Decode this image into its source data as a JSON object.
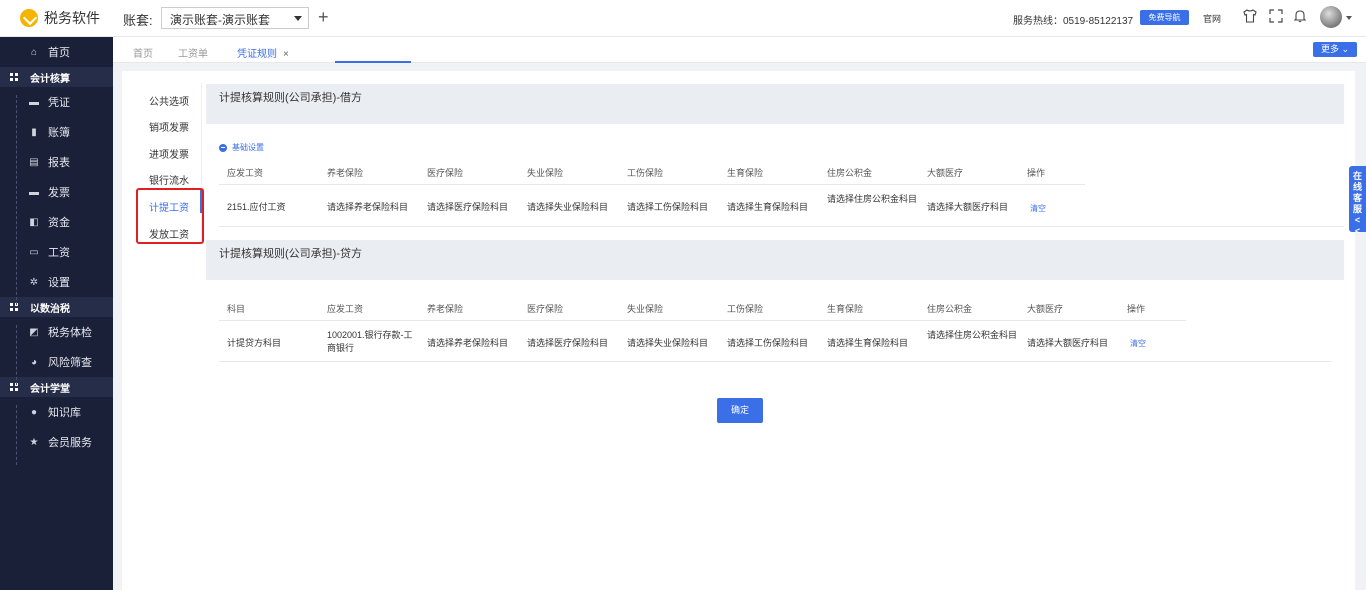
{
  "app": {
    "name": "税务软件"
  },
  "header": {
    "account_label": "账套:",
    "account_value": "演示账套-演示账套",
    "add_symbol": "+",
    "hotline": "服务热线：0519-85122137",
    "free_nav": "免费导航",
    "homepage": "官网"
  },
  "sidebar": {
    "home": "首页",
    "section1": "会计核算",
    "items1": [
      "凭证",
      "账簿",
      "报表",
      "发票",
      "资金",
      "工资",
      "设置"
    ],
    "section2": "以数治税",
    "items2": [
      "税务体检",
      "风险筛查"
    ],
    "section3": "会计学堂",
    "items3": [
      "知识库",
      "会员服务"
    ]
  },
  "tabs": {
    "items": [
      "首页",
      "工资单",
      "凭证规则"
    ],
    "close": "×",
    "more": "更多 ⌄"
  },
  "leftnav": {
    "items": [
      "公共选项",
      "销项发票",
      "进项发票",
      "银行流水",
      "计提工资",
      "发放工资"
    ],
    "active_index": 4
  },
  "debit": {
    "title": "计提核算规则(公司承担)-借方",
    "basic_settings": "基础设置",
    "headers": [
      "应发工资",
      "养老保险",
      "医疗保险",
      "失业保险",
      "工伤保险",
      "生育保险",
      "住房公积金",
      "大额医疗",
      "操作"
    ],
    "row": [
      "2151.应付工资",
      "请选择养老保险科目",
      "请选择医疗保险科目",
      "请选择失业保险科目",
      "请选择工伤保险科目",
      "请选择生育保险科目",
      "请选择住房公积金科目",
      "请选择大额医疗科目",
      "清空"
    ]
  },
  "credit": {
    "title": "计提核算规则(公司承担)-贷方",
    "headers": [
      "科目",
      "应发工资",
      "养老保险",
      "医疗保险",
      "失业保险",
      "工伤保险",
      "生育保险",
      "住房公积金",
      "大额医疗",
      "操作"
    ],
    "row": [
      "计提贷方科目",
      "1002001.银行存款-工商银行",
      "请选择养老保险科目",
      "请选择医疗保险科目",
      "请选择失业保险科目",
      "请选择工伤保险科目",
      "请选择生育保险科目",
      "请选择住房公积金科目",
      "请选择大额医疗科目",
      "清空"
    ]
  },
  "confirm": "确定",
  "online_service": "在线客服<<",
  "colors": {
    "accent": "#3a6fe8",
    "sidebar": "#1a2038",
    "highlight": "#e02020"
  }
}
